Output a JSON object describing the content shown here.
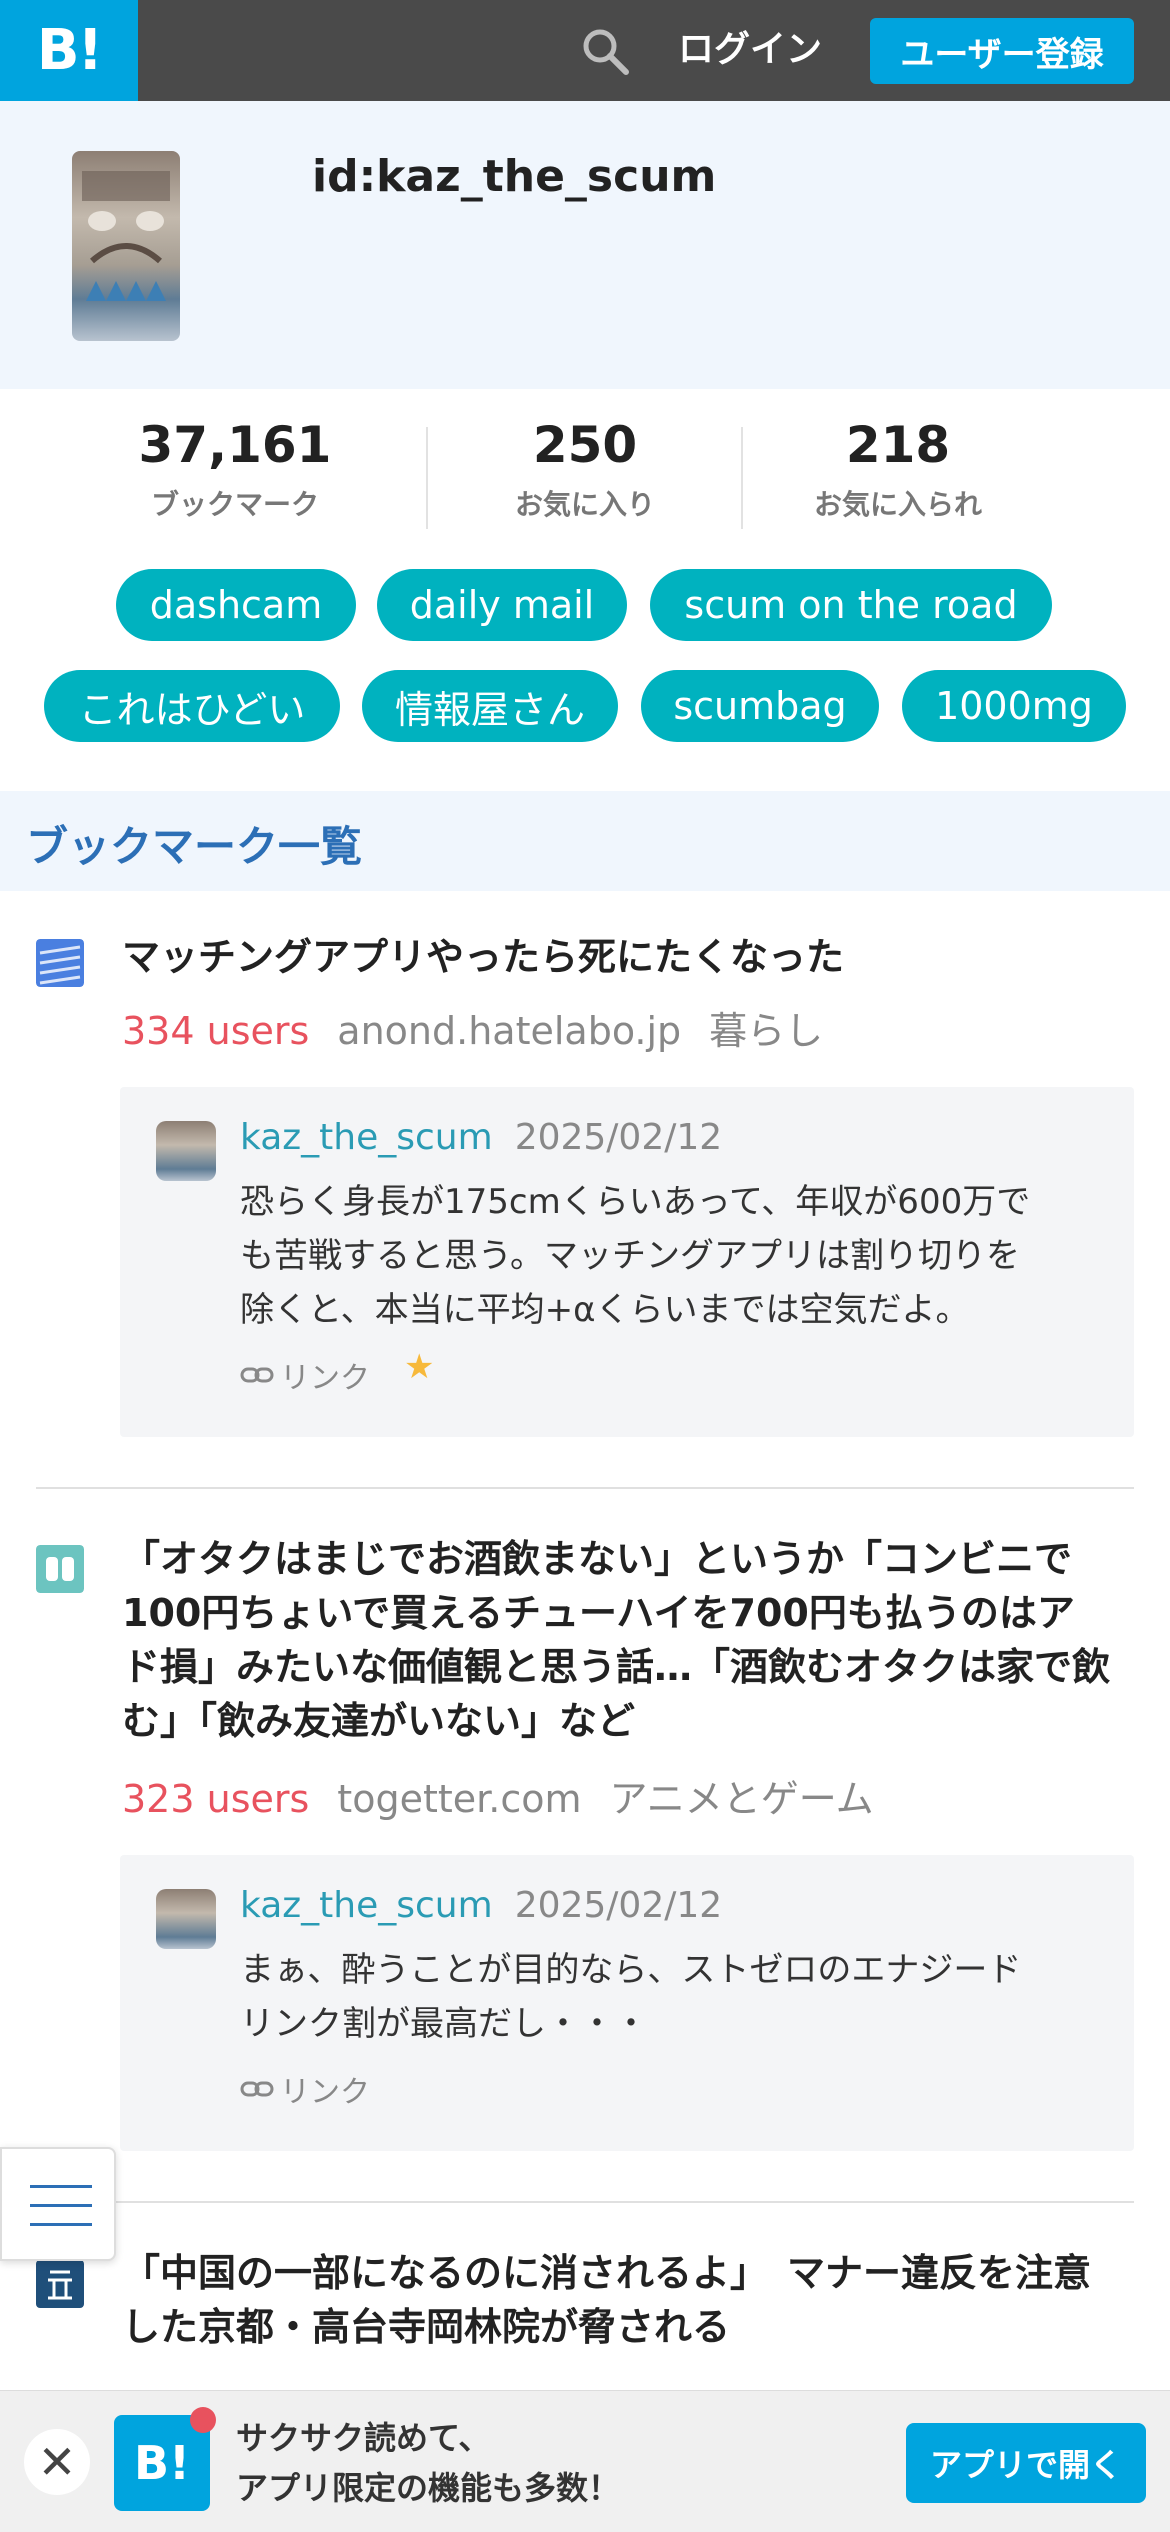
{
  "header": {
    "logo": "B!",
    "search_icon": "search-icon",
    "login": "ログイン",
    "signup": "ユーザー登録"
  },
  "profile": {
    "id": "id:kaz_the_scum"
  },
  "stats": [
    {
      "value": "37,161",
      "label": "ブックマーク"
    },
    {
      "value": "250",
      "label": "お気に入り"
    },
    {
      "value": "218",
      "label": "お気に入られ"
    }
  ],
  "tags": [
    "dashcam",
    "daily mail",
    "scum on the road",
    "これはひどい",
    "情報屋さん",
    "scumbag",
    "1000mg"
  ],
  "section": {
    "title": "ブックマーク一覧"
  },
  "entries": [
    {
      "favicon": "hatelabo-icon",
      "title": "マッチングアプリやったら死にたくなった",
      "users": "334 users",
      "domain": "anond.hatelabo.jp",
      "category": "暮らし",
      "comment": {
        "user": "kaz_the_scum",
        "date": "2025/02/12",
        "lines": [
          "恐らく身長が175cmくらいあって、年収が600万で",
          "も苦戦すると思う。マッチングアプリは割り切りを",
          "除くと、本当に平均+αくらいまでは空気だよ。"
        ],
        "link": "リンク",
        "star": "★"
      }
    },
    {
      "favicon": "togetter-icon",
      "title_lines": [
        "「オタクはまじでお酒飲まない」というか「コンビニで",
        "100円ちょいで買えるチューハイを700円も払うのはア",
        "ド損」みたいな価値観と思う話…「酒飲むオタクは家で飲",
        "む」「飲み友達がいない」など"
      ],
      "users": "323 users",
      "domain": "togetter.com",
      "category": "アニメとゲーム",
      "comment": {
        "user": "kaz_the_scum",
        "date": "2025/02/12",
        "lines": [
          "まぁ、酔うことが目的なら、ストゼロのエナジード",
          "リンク割が最高だし・・・"
        ],
        "link": "リンク"
      }
    },
    {
      "favicon": "sankei-icon",
      "title_lines": [
        "「中国の一部になるのに消されるよ」　マナー違反を注意",
        "した京都・高台寺岡林院が脅される"
      ]
    }
  ],
  "app_banner": {
    "close": "✕",
    "icon": "B!",
    "line1": "サクサク読めて、",
    "line2": "アプリ限定の機能も多数！",
    "open": "アプリで開く"
  },
  "colors": {
    "brand": "#00a4de",
    "tag": "#00b2bf",
    "users": "#e8525e",
    "username": "#2a9bb4",
    "section": "#2c6fb6"
  }
}
